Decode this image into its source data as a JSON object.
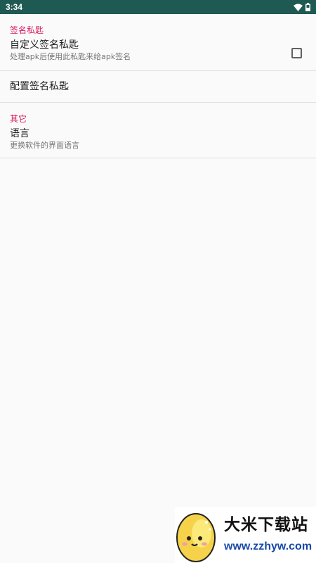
{
  "status_bar": {
    "time": "3:34",
    "icons": [
      "wifi-icon",
      "battery-icon"
    ]
  },
  "sections": [
    {
      "header": "签名私匙",
      "items": [
        {
          "title": "自定义签名私匙",
          "summary": "处理apk后使用此私匙来给apk签名",
          "control": "checkbox",
          "checked": false
        },
        {
          "title": "配置签名私匙"
        }
      ]
    },
    {
      "header": "其它",
      "items": [
        {
          "title": "语言",
          "summary": "更换软件的界面语言"
        }
      ]
    }
  ],
  "watermark": {
    "title": "大米下载站",
    "url": "www.zzhyw.com"
  },
  "colors": {
    "status_bar": "#1f5a52",
    "accent": "#d81b60",
    "background": "#fafafa"
  }
}
